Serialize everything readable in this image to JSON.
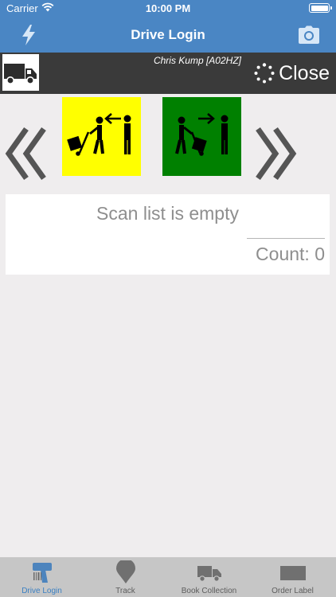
{
  "status_bar": {
    "carrier": "Carrier",
    "time": "10:00 PM"
  },
  "nav_bar": {
    "title": "Drive Login",
    "left_icon": "lightning-bolt-icon",
    "right_icon": "camera-icon"
  },
  "user_bar": {
    "vehicle_icon": "truck-icon",
    "user_name": "Chris Kump [A02HZ]",
    "close_label": "Close",
    "spinner_icon": "loading-spinner-icon"
  },
  "actions": {
    "prev_icon": "double-chevron-left-icon",
    "next_icon": "double-chevron-right-icon",
    "collect": {
      "color": "#ffff00",
      "icon": "collect-parcel-icon"
    },
    "deliver": {
      "color": "#008000",
      "icon": "deliver-parcel-icon"
    }
  },
  "scan_list": {
    "empty_text": "Scan list is empty",
    "count_text": "Count: 0"
  },
  "tab_bar": {
    "items": [
      {
        "label": "Drive Login",
        "icon": "barcode-scanner-icon",
        "active": true
      },
      {
        "label": "Track",
        "icon": "map-pin-icon",
        "active": false
      },
      {
        "label": "Book Collection",
        "icon": "truck-icon",
        "active": false
      },
      {
        "label": "Order Label",
        "icon": "label-printer-icon",
        "active": false
      }
    ]
  },
  "colors": {
    "header": "#4a86c4",
    "user_bar": "#3a3a3a",
    "background": "#efedee",
    "active_tab": "#3a7fc2",
    "tab_bar": "#c6c6c6"
  }
}
